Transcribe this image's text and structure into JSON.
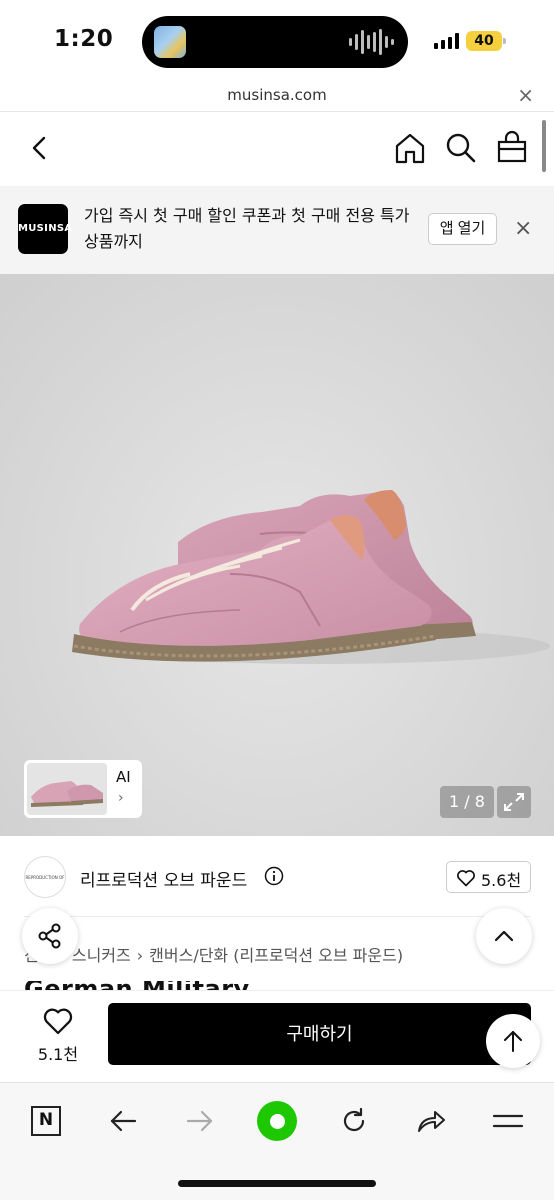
{
  "status_bar": {
    "time": "1:20",
    "battery": "40"
  },
  "browser": {
    "url": "musinsa.com"
  },
  "header": {
    "back_icon": "chevron-left-icon",
    "home_icon": "home-icon",
    "search_icon": "search-icon",
    "cart_icon": "shopping-bag-icon"
  },
  "promo": {
    "logo_text": "MUSINSA",
    "message": "가입 즉시 첫 구매 할인 쿠폰과 첫 구매 전용 특가 상품까지",
    "open_app_label": "앱 열기"
  },
  "gallery": {
    "ai_label": "AI",
    "page_counter": "1 / 8",
    "current_page": 1,
    "total_pages": 8
  },
  "brand": {
    "name": "리프로덕션 오브 파운드",
    "logo_text": "REPRODUCTION OF FOUND",
    "likes": "5.6천"
  },
  "breadcrumb": [
    "신발",
    "스니커즈",
    "캔버스/단화 (리프로덕션 오브 파운드)"
  ],
  "product": {
    "title_partial": "German Military Trainer"
  },
  "buy_bar": {
    "wish_count": "5.1천",
    "buy_label": "구매하기"
  },
  "colors": {
    "brand_black": "#000000",
    "browser_green": "#1ec800",
    "battery_yellow": "#f4d03f",
    "shoe_pink": "#d9a3b6",
    "sole_gum": "#8c7a62"
  }
}
